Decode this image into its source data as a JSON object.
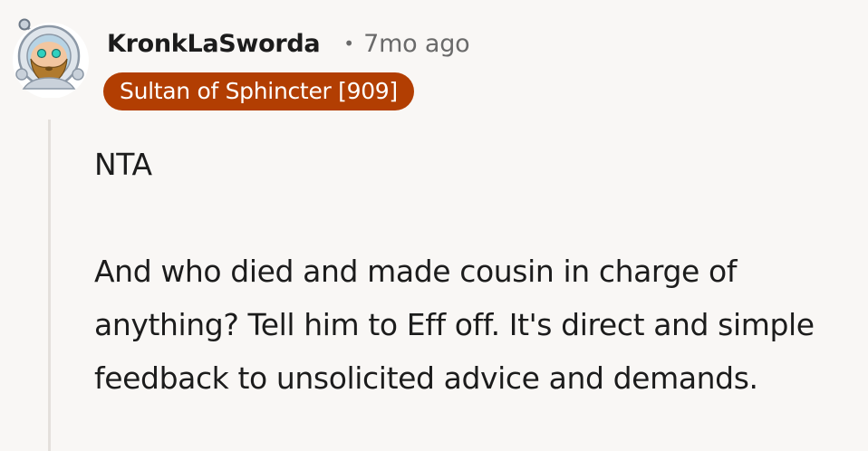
{
  "comment": {
    "author": "KronkLaSworda",
    "separator": "•",
    "timestamp": "7mo ago",
    "flair": "Sultan of Sphincter [909]",
    "paragraphs": [
      "NTA",
      "And who died and made cousin in charge of anything? Tell him to Eff off. It's direct and simple feedback to unsolicited advice and demands."
    ]
  },
  "colors": {
    "background": "#f9f7f5",
    "flair_background": "#b23e02",
    "flair_text": "#ffffff",
    "meta_text": "#6a6a6a",
    "thread_line": "#e4e0dc"
  },
  "icons": {
    "avatar": "snoo-astronaut-avatar-icon"
  }
}
